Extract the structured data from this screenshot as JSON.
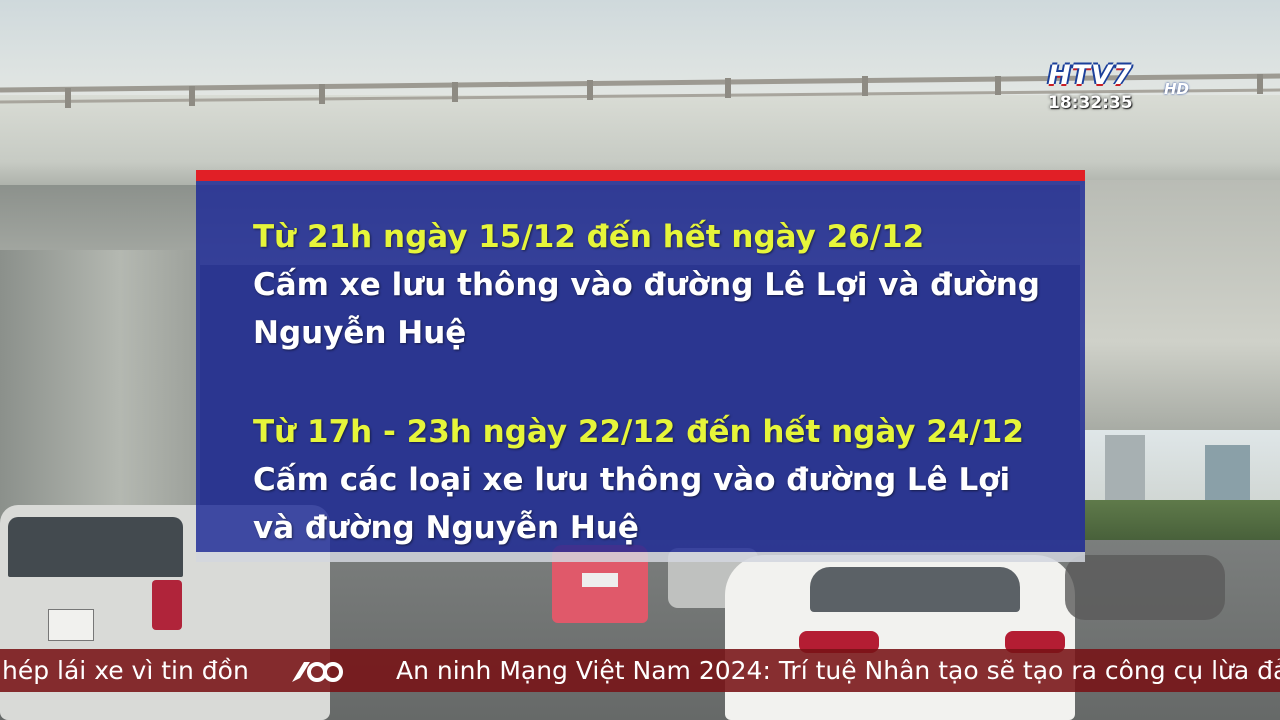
{
  "broadcast": {
    "channel_logo": "HTV7",
    "channel_hd": "HD",
    "clock": "18:32:35"
  },
  "notice": {
    "block1": {
      "heading": "Từ 21h ngày 15/12 đến hết ngày 26/12",
      "text": "Cấm xe lưu thông vào đường Lê Lợi và đường Nguyễn Huệ"
    },
    "block2": {
      "heading": "Từ 17h - 23h ngày 22/12 đến hết ngày 24/12",
      "text": "Cấm các loại xe lưu thông vào đường Lê Lợi và đường Nguyễn Huệ"
    }
  },
  "ticker": {
    "left_text": "hép lái xe vì tin đồn",
    "icon": "60s-logo-icon",
    "right_text": "An ninh Mạng Việt Nam 2024: Trí tuệ Nhân tạo sẽ tạo ra công cụ lừa đả"
  },
  "colors": {
    "panel_bar": "#e11f26",
    "panel_bg": "#1c2896",
    "highlight_text": "#e6f53a",
    "ticker_bg": "#781216"
  }
}
